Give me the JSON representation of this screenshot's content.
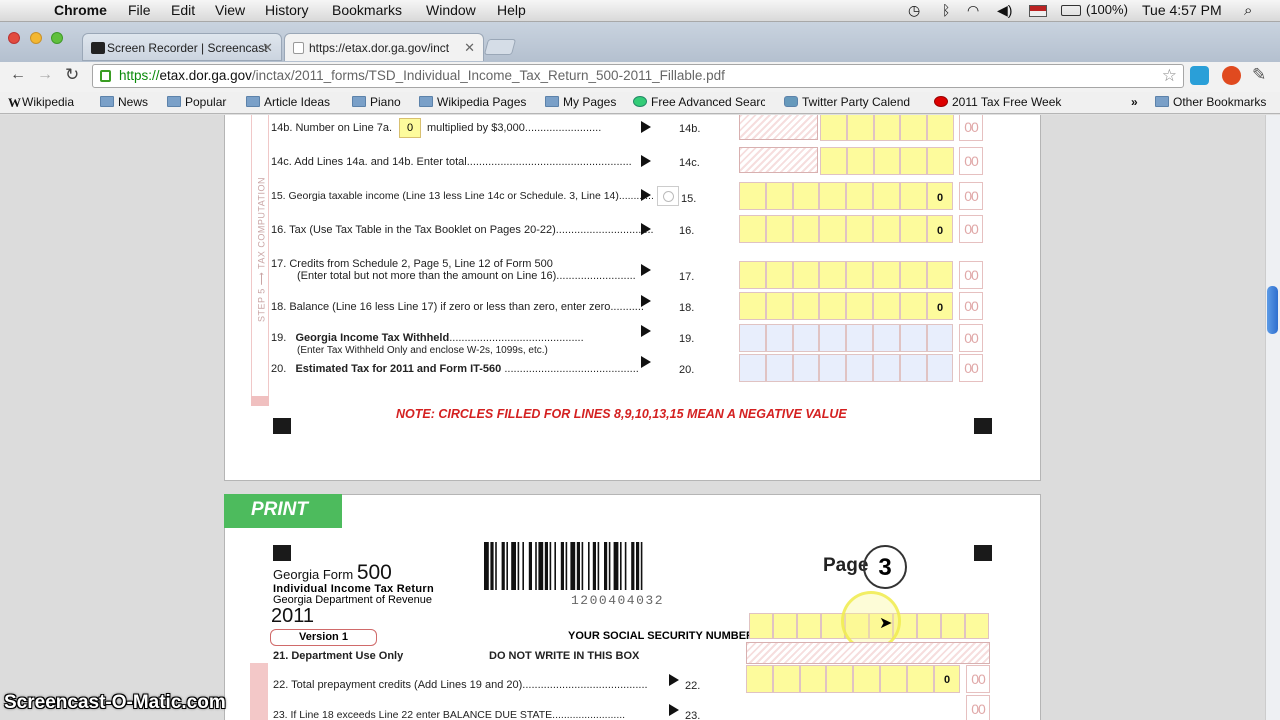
{
  "menubar": {
    "apple": "",
    "app": "Chrome",
    "items": [
      "File",
      "Edit",
      "View",
      "History",
      "Bookmarks",
      "Window",
      "Help"
    ],
    "battery": "(100%)",
    "clock": "Tue 4:57 PM"
  },
  "tabs": [
    {
      "title": "Screen Recorder | Screencast"
    },
    {
      "title": "https://etax.dor.ga.gov/inct"
    }
  ],
  "address": {
    "secure": "https://",
    "host": "etax.dor.ga.gov",
    "path": "/inctax/2011_forms/TSD_Individual_Income_Tax_Return_500-2011_Fillable.pdf"
  },
  "bookmarks": [
    "Wikipedia",
    "News",
    "Popular",
    "Article Ideas",
    "Piano",
    "Wikipedia Pages",
    "My Pages",
    "Free Advanced Searc",
    "Twitter Party Calend",
    "2011 Tax Free Week"
  ],
  "other_bookmarks": "Other Bookmarks",
  "form_top": {
    "side_label": "STEP 5 ⟶ TAX COMPUTATION",
    "lines": [
      {
        "text": "14b.  Number on Line 7a.",
        "box": "0",
        "tail": "multiplied by $3,000.........................",
        "num": "14b."
      },
      {
        "text": "14c.  Add Lines 14a. and 14b. Enter total......................................................",
        "num": "14c."
      },
      {
        "text": "15.   Georgia taxable income (Line 13 less Line 14c or Schedule. 3, Line 14)............",
        "num": "15.",
        "value": "0"
      },
      {
        "text": "16.   Tax (Use Tax Table in the Tax Booklet on Pages 20-22)................................",
        "num": "16.",
        "value": "0"
      },
      {
        "text": "17.   Credits from Schedule 2, Page 5, Line 12 of Form 500",
        "text2": "(Enter total but not more than the amount on Line 16)..........................",
        "num": "17."
      },
      {
        "text": "18.   Balance (Line 16 less Line 17) if zero or less than zero, enter zero...........",
        "num": "18.",
        "value": "0"
      },
      {
        "text": "19.",
        "bold": "Georgia Income Tax Withheld",
        "tail": "............................................",
        "text2": "(Enter Tax Withheld Only and enclose W-2s, 1099s, etc.)",
        "num": "19."
      },
      {
        "text": "20.",
        "bold": "Estimated Tax for 2011 and Form IT-560",
        "tail": " ............................................",
        "num": "20."
      }
    ],
    "note": "NOTE: CIRCLES FILLED FOR LINES 8,9,10,13,15 MEAN A NEGATIVE VALUE",
    "cents": "00"
  },
  "form_bottom": {
    "print": "PRINT",
    "form_title": "Georgia Form",
    "form_num": "500",
    "subtitle": "Individual Income Tax Return",
    "dept": "Georgia Department of Revenue",
    "year": "2011",
    "version": "Version 1",
    "barcode_num": "1200404032",
    "page_label": "Page",
    "page_num": "3",
    "ssn_label": "YOUR SOCIAL SECURITY NUMBER",
    "line21": "21.     Department Use Only",
    "dnw": "DO NOT WRITE IN THIS BOX",
    "line22": "22.     Total prepayment credits (Add Lines 19 and 20).........................................",
    "num22": "22.",
    "value22": "0",
    "line23": "23.     If Line 18 exceeds Line 22 enter BALANCE DUE STATE.........................",
    "num23": "23."
  },
  "watermark": "Screencast-O-Matic.com"
}
